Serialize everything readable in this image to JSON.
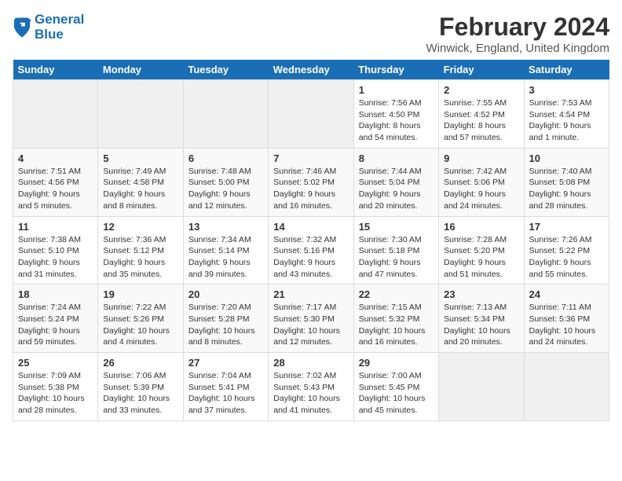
{
  "logo": {
    "line1": "General",
    "line2": "Blue"
  },
  "title": "February 2024",
  "subtitle": "Winwick, England, United Kingdom",
  "days_of_week": [
    "Sunday",
    "Monday",
    "Tuesday",
    "Wednesday",
    "Thursday",
    "Friday",
    "Saturday"
  ],
  "weeks": [
    [
      {
        "day": null
      },
      {
        "day": null
      },
      {
        "day": null
      },
      {
        "day": null
      },
      {
        "day": 1,
        "sunrise": "7:56 AM",
        "sunset": "4:50 PM",
        "daylight": "8 hours and 54 minutes."
      },
      {
        "day": 2,
        "sunrise": "7:55 AM",
        "sunset": "4:52 PM",
        "daylight": "8 hours and 57 minutes."
      },
      {
        "day": 3,
        "sunrise": "7:53 AM",
        "sunset": "4:54 PM",
        "daylight": "9 hours and 1 minute."
      }
    ],
    [
      {
        "day": 4,
        "sunrise": "7:51 AM",
        "sunset": "4:56 PM",
        "daylight": "9 hours and 5 minutes."
      },
      {
        "day": 5,
        "sunrise": "7:49 AM",
        "sunset": "4:58 PM",
        "daylight": "9 hours and 8 minutes."
      },
      {
        "day": 6,
        "sunrise": "7:48 AM",
        "sunset": "5:00 PM",
        "daylight": "9 hours and 12 minutes."
      },
      {
        "day": 7,
        "sunrise": "7:46 AM",
        "sunset": "5:02 PM",
        "daylight": "9 hours and 16 minutes."
      },
      {
        "day": 8,
        "sunrise": "7:44 AM",
        "sunset": "5:04 PM",
        "daylight": "9 hours and 20 minutes."
      },
      {
        "day": 9,
        "sunrise": "7:42 AM",
        "sunset": "5:06 PM",
        "daylight": "9 hours and 24 minutes."
      },
      {
        "day": 10,
        "sunrise": "7:40 AM",
        "sunset": "5:08 PM",
        "daylight": "9 hours and 28 minutes."
      }
    ],
    [
      {
        "day": 11,
        "sunrise": "7:38 AM",
        "sunset": "5:10 PM",
        "daylight": "9 hours and 31 minutes."
      },
      {
        "day": 12,
        "sunrise": "7:36 AM",
        "sunset": "5:12 PM",
        "daylight": "9 hours and 35 minutes."
      },
      {
        "day": 13,
        "sunrise": "7:34 AM",
        "sunset": "5:14 PM",
        "daylight": "9 hours and 39 minutes."
      },
      {
        "day": 14,
        "sunrise": "7:32 AM",
        "sunset": "5:16 PM",
        "daylight": "9 hours and 43 minutes."
      },
      {
        "day": 15,
        "sunrise": "7:30 AM",
        "sunset": "5:18 PM",
        "daylight": "9 hours and 47 minutes."
      },
      {
        "day": 16,
        "sunrise": "7:28 AM",
        "sunset": "5:20 PM",
        "daylight": "9 hours and 51 minutes."
      },
      {
        "day": 17,
        "sunrise": "7:26 AM",
        "sunset": "5:22 PM",
        "daylight": "9 hours and 55 minutes."
      }
    ],
    [
      {
        "day": 18,
        "sunrise": "7:24 AM",
        "sunset": "5:24 PM",
        "daylight": "9 hours and 59 minutes."
      },
      {
        "day": 19,
        "sunrise": "7:22 AM",
        "sunset": "5:26 PM",
        "daylight": "10 hours and 4 minutes."
      },
      {
        "day": 20,
        "sunrise": "7:20 AM",
        "sunset": "5:28 PM",
        "daylight": "10 hours and 8 minutes."
      },
      {
        "day": 21,
        "sunrise": "7:17 AM",
        "sunset": "5:30 PM",
        "daylight": "10 hours and 12 minutes."
      },
      {
        "day": 22,
        "sunrise": "7:15 AM",
        "sunset": "5:32 PM",
        "daylight": "10 hours and 16 minutes."
      },
      {
        "day": 23,
        "sunrise": "7:13 AM",
        "sunset": "5:34 PM",
        "daylight": "10 hours and 20 minutes."
      },
      {
        "day": 24,
        "sunrise": "7:11 AM",
        "sunset": "5:36 PM",
        "daylight": "10 hours and 24 minutes."
      }
    ],
    [
      {
        "day": 25,
        "sunrise": "7:09 AM",
        "sunset": "5:38 PM",
        "daylight": "10 hours and 28 minutes."
      },
      {
        "day": 26,
        "sunrise": "7:06 AM",
        "sunset": "5:39 PM",
        "daylight": "10 hours and 33 minutes."
      },
      {
        "day": 27,
        "sunrise": "7:04 AM",
        "sunset": "5:41 PM",
        "daylight": "10 hours and 37 minutes."
      },
      {
        "day": 28,
        "sunrise": "7:02 AM",
        "sunset": "5:43 PM",
        "daylight": "10 hours and 41 minutes."
      },
      {
        "day": 29,
        "sunrise": "7:00 AM",
        "sunset": "5:45 PM",
        "daylight": "10 hours and 45 minutes."
      },
      {
        "day": null
      },
      {
        "day": null
      }
    ]
  ]
}
